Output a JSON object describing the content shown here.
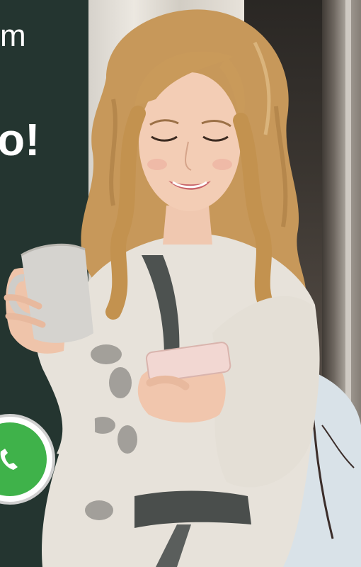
{
  "poster": {
    "text_top": "m",
    "text_middle": "o!"
  },
  "badge": {
    "icon": "whatsapp-phone-icon",
    "color": "#3fb24a"
  },
  "colors": {
    "dark_panel": "#243530",
    "hair": "#c99a5a",
    "robe": "#e7e2da",
    "phone": "#f2d7d2"
  }
}
